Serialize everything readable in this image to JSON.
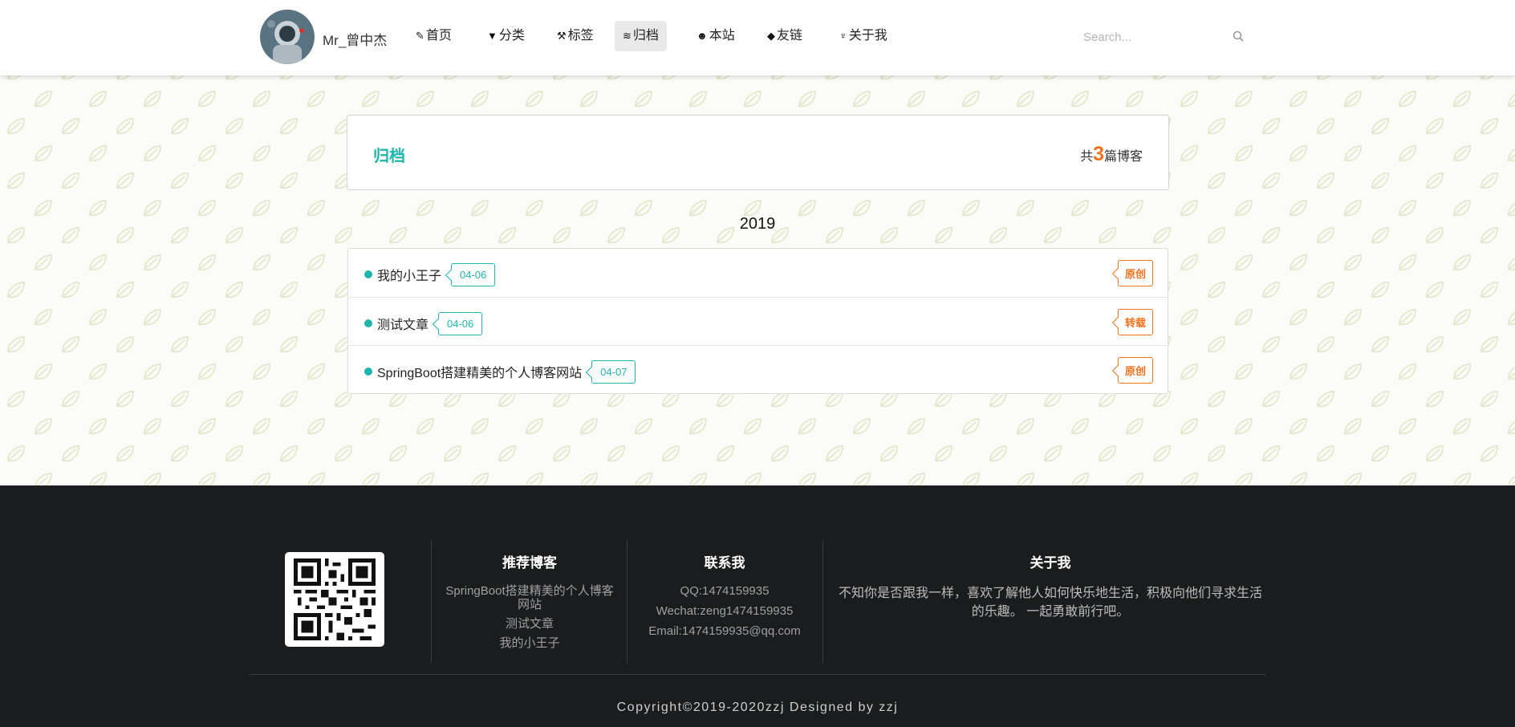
{
  "nav": {
    "brand": "Mr_曾中杰",
    "items": [
      {
        "label": "首页",
        "icon": "pencil-icon"
      },
      {
        "label": "分类",
        "icon": "ice-cream-icon"
      },
      {
        "label": "标签",
        "icon": "wrench-icon"
      },
      {
        "label": "归档",
        "icon": "wave-icon"
      },
      {
        "label": "本站",
        "icon": "smile-icon"
      },
      {
        "label": "友链",
        "icon": "fish-icon"
      },
      {
        "label": "关于我",
        "icon": "sprout-icon"
      }
    ],
    "active": "归档",
    "search_placeholder": "Search..."
  },
  "archive": {
    "title": "归档",
    "count_prefix": "共",
    "count": "3",
    "count_suffix": "篇博客",
    "year": "2019",
    "posts": [
      {
        "title": "我的小王子",
        "date": "04-06",
        "type": "原创"
      },
      {
        "title": "测试文章",
        "date": "04-06",
        "type": "转载"
      },
      {
        "title": "SpringBoot搭建精美的个人博客网站",
        "date": "04-07",
        "type": "原创"
      }
    ]
  },
  "footer": {
    "recommend_title": "推荐博客",
    "recommend": [
      "SpringBoot搭建精美的个人博客网站",
      "测试文章",
      "我的小王子"
    ],
    "contact_title": "联系我",
    "contact": [
      "QQ:1474159935",
      "Wechat:zeng1474159935",
      "Email:1474159935@qq.com"
    ],
    "about_title": "关于我",
    "about_text": "不知你是否跟我一样，喜欢了解他人如何快乐地生活，积极向他们寻求生活的乐趣。 一起勇敢前行吧。",
    "copyright": "Copyright©2019-2020zzj Designed by zzj"
  },
  "colors": {
    "accent": "#1fb5ac",
    "orange": "#f2711c",
    "footer_bg": "#1b1c1d"
  }
}
